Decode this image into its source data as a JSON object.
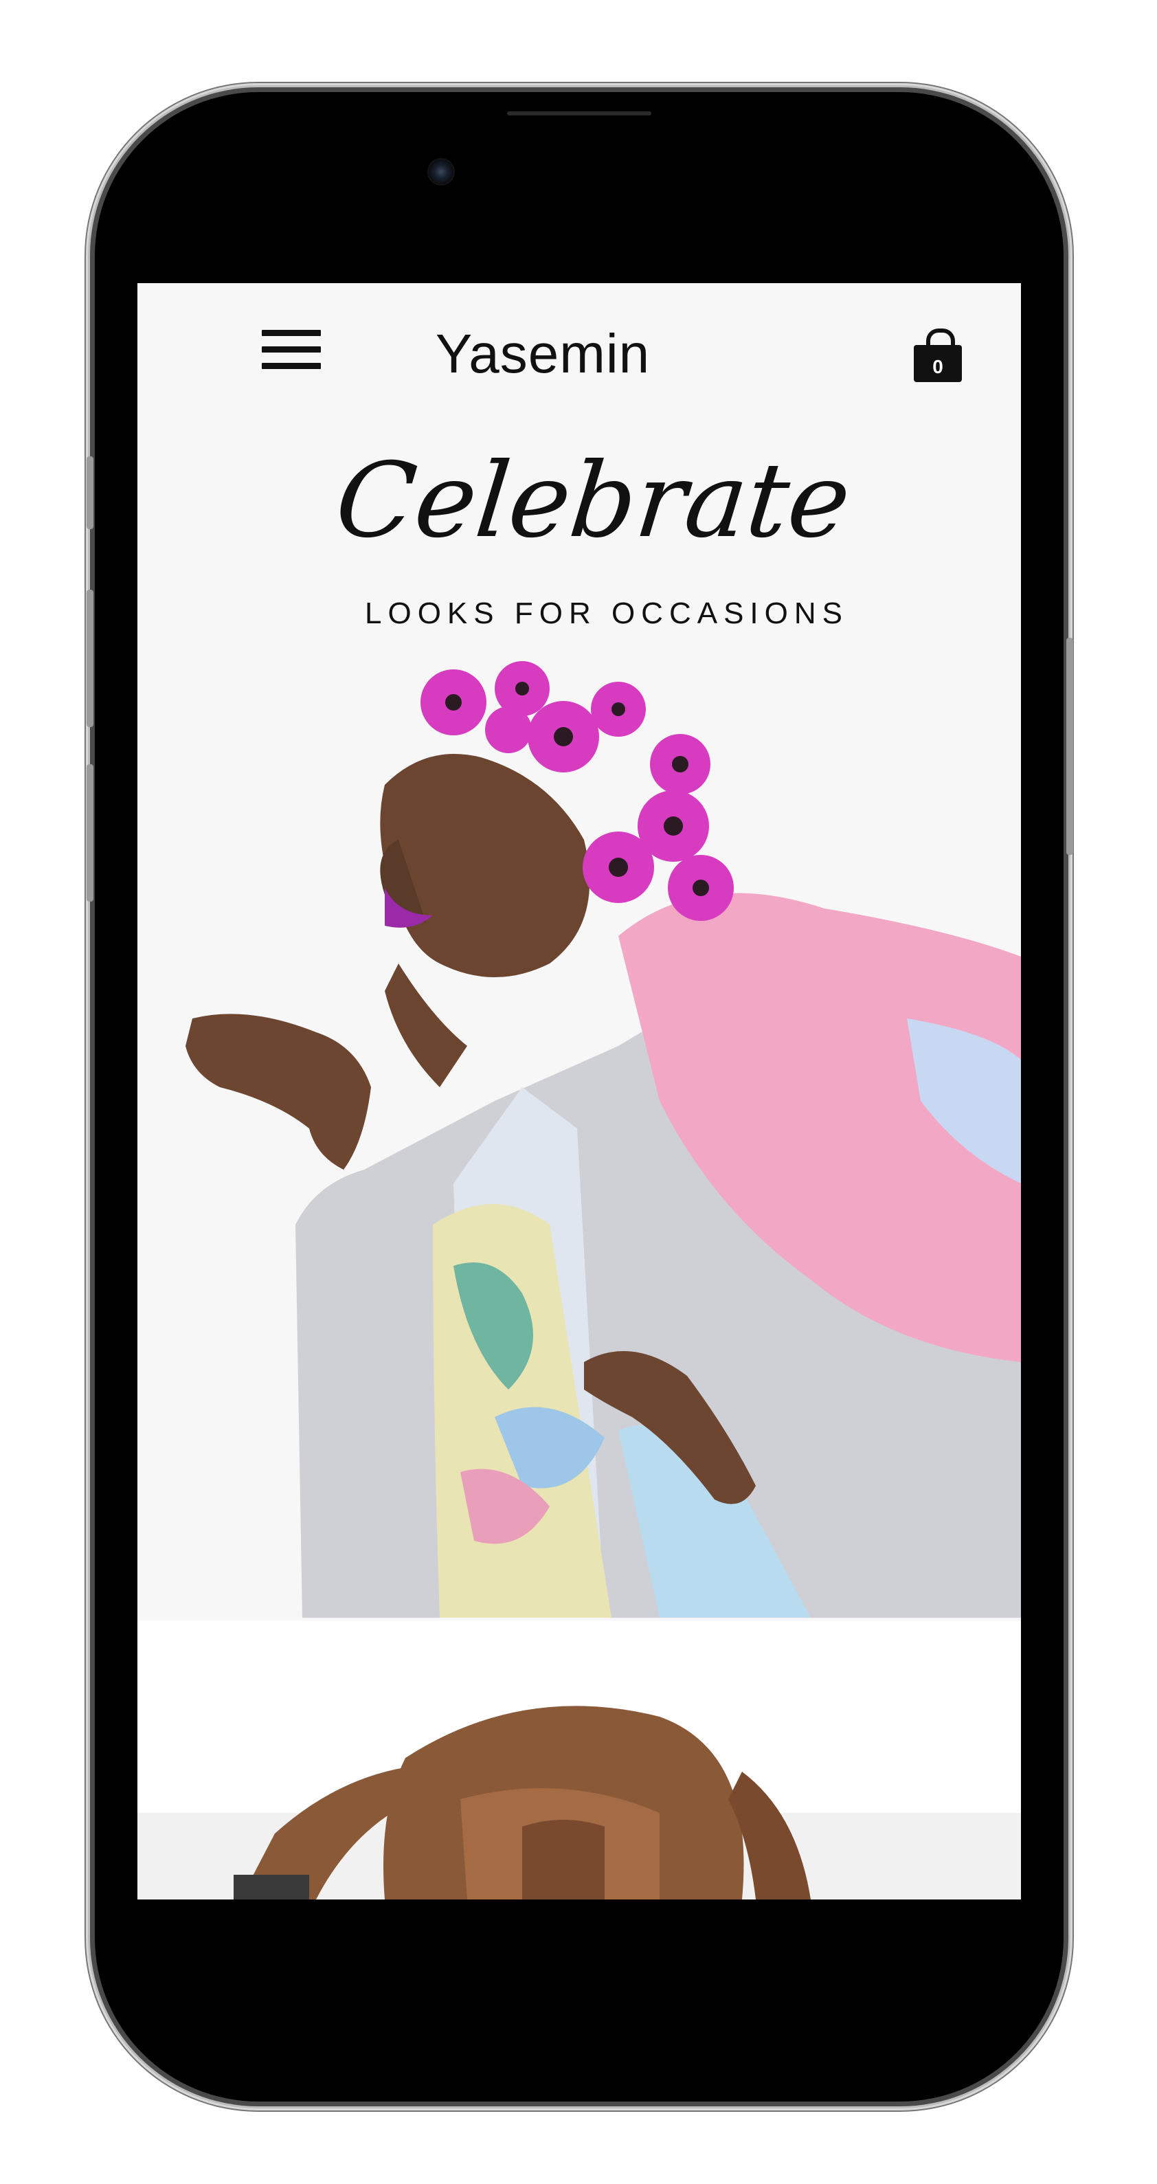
{
  "header": {
    "menu_icon": "hamburger-menu-icon",
    "brand": "Yasemin",
    "cart_icon": "shopping-bag-icon",
    "cart_count": "0"
  },
  "hero": {
    "title": "Celebrate",
    "subtitle": "LOOKS FOR OCCASIONS"
  },
  "colors": {
    "background": "#f7f7f7",
    "text": "#111111",
    "accent_pink": "#e63fb8"
  }
}
